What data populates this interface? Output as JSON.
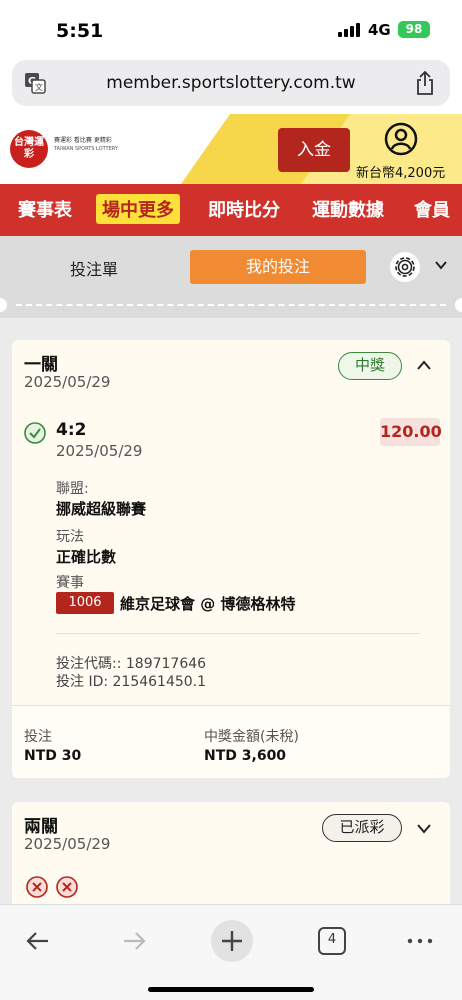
{
  "status": {
    "time": "5:51",
    "network": "4G",
    "battery": "98"
  },
  "browser": {
    "url": "member.sportslottery.com.tw",
    "tab_count": "4"
  },
  "site": {
    "logo_main": "台灣運彩",
    "logo_tagline": "賽運彩 看比賽 更精彩",
    "logo_sub": "TAIWAN SPORTS LOTTERY",
    "deposit_label": "入金",
    "balance": "新台幣4,200元"
  },
  "nav": {
    "items": [
      "賽事表",
      "場中更多",
      "即時比分",
      "運動數據",
      "會員"
    ],
    "active_index": 1
  },
  "tabs": {
    "bet_slip": "投注單",
    "my_bets": "我的投注"
  },
  "card1": {
    "title": "一關",
    "date": "2025/05/29",
    "status": "中獎",
    "selection": "4:2",
    "selection_date": "2025/05/29",
    "odds": "120.00",
    "league_label": "聯盟:",
    "league": "挪威超級聯賽",
    "market_label": "玩法",
    "market": "正確比數",
    "event_label": "賽事",
    "event_code": "1006",
    "event_name": "維京足球會 @ 博德格林特",
    "bet_code": "投注代碼:: 189717646",
    "bet_id": "投注 ID: 215461450.1",
    "stake_label": "投注",
    "stake": "NTD 30",
    "payout_label": "中獎金額(未稅)",
    "payout": "NTD 3,600"
  },
  "card2": {
    "title": "兩關",
    "date": "2025/05/29",
    "status": "已派彩"
  },
  "colors": {
    "brand_red": "#d0312b",
    "accent_orange": "#f08a33",
    "win_green": "#2f7a2f",
    "nav_highlight": "#fde03a"
  }
}
